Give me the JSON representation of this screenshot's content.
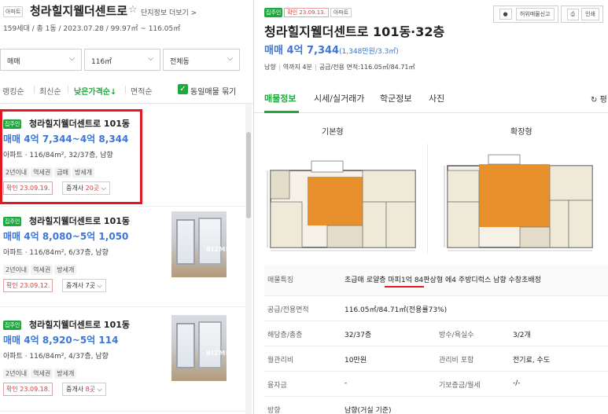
{
  "complex": {
    "type_tag": "아파트",
    "name": "청라힐지웰더센트로",
    "more_link": "단지정보 더보기 >",
    "info": "159세대 / 총 1동 / 2023.07.28 / 99.97㎡ ~ 116.05㎡"
  },
  "filters": {
    "deal": "매매",
    "area": "116㎡",
    "building": "전체동"
  },
  "sort": {
    "options": [
      "랭킹순",
      "최신순",
      "낮은가격순↓",
      "면적순"
    ],
    "same_listing_label": "동일매물 묶기"
  },
  "listings": [
    {
      "badge": "집주인",
      "name": "청라힐지웰더센트로 101동",
      "price": "매매 4억 7,344~4억 8,344",
      "desc": "아파트 · 116/84m², 32/37층, 남향",
      "tags": [
        "2년이내",
        "역세권",
        "급매",
        "방세개"
      ],
      "confirm": "확인 23.09.19.",
      "agent_prefix": "중개사 ",
      "agent_count": "20곳"
    },
    {
      "badge": "집주인",
      "name": "청라힐지웰더센트로 101동",
      "price": "매매 4억 8,080~5억 1,050",
      "desc": "아파트 · 116/84m², 6/37층, 남향",
      "tags": [
        "2년이내",
        "역세권",
        "방세개"
      ],
      "confirm": "확인 23.09.12.",
      "agent_prefix": "중개사 ",
      "agent_count": "7곳",
      "photo_watermark": "BIZMI"
    },
    {
      "badge": "집주인",
      "name": "청라힐지웰더센트로 101동",
      "price": "매매 4억 8,920~5억 114",
      "desc": "아파트 · 116/84m², 4/37층, 남향",
      "tags": [
        "2년이내",
        "역세권",
        "방세개"
      ],
      "confirm": "확인 23.09.18.",
      "agent_prefix": "중개사 ",
      "agent_count": "8곳",
      "photo_watermark": "BIZMI"
    }
  ],
  "detail": {
    "badge": "집주인",
    "confirm": "확인 23.09.13.",
    "type": "아파트",
    "report_btn": "허위매물신고",
    "print_btn": "인쇄",
    "title": "청라힐지웰더센트로 101동·32층",
    "price": "매매 4억 7,344",
    "price_sub": "(1,348만원/3.3㎡)",
    "sub": [
      "남향",
      "역까지 4분",
      "공급/전용 면적:116.05㎡/84.71㎡"
    ],
    "tabs": [
      "매물정보",
      "시세/실거래가",
      "학군정보",
      "사진"
    ],
    "refresh": "평",
    "floorplans": [
      "기본형",
      "확장형"
    ],
    "specs": [
      {
        "k": "매물특징",
        "v": "초급매 로얄층 마피1억 84판상형 에4 주방디럭스 남향 수창초배정"
      },
      {
        "k": "공급/전용면적",
        "v": "116.05㎡/84.71㎡(전용률73%)"
      },
      {
        "k": "해당층/총층",
        "v": "32/37층",
        "k2": "방수/욕실수",
        "v2": "3/2개"
      },
      {
        "k": "월관리비",
        "v": "10만원",
        "k2": "관리비 포함",
        "v2": "전기료, 수도"
      },
      {
        "k": "융자금",
        "v": "-",
        "k2": "기보증금/월세",
        "v2": "-/-"
      },
      {
        "k": "방향",
        "v": "남향(거실 기준)"
      }
    ]
  },
  "colors": {
    "accent_green": "#1ea83d",
    "price_blue": "#3c76d6",
    "highlight_red": "#e5171f"
  }
}
